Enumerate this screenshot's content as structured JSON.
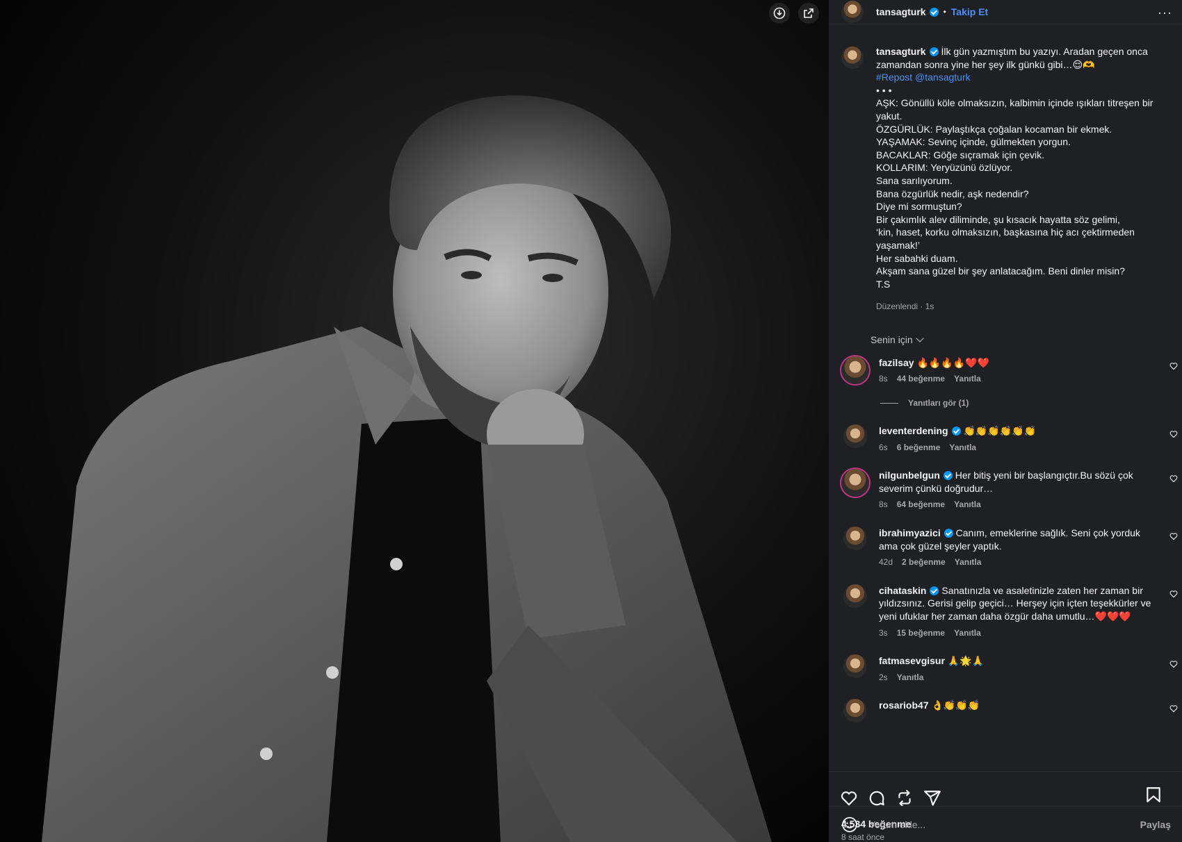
{
  "media": {
    "download_icon": "download-icon",
    "share_icon": "share-external-icon"
  },
  "post": {
    "author": "tansagturk",
    "follow_label": "Takip Et",
    "more_icon": "more-horizontal-icon",
    "caption_lines": [
      "İlk gün yazmıştım bu yazıyı. Aradan geçen onca zamandan sonra yine her şey ilk günkü gibi…😌🫶",
      "#Repost @tansagturk",
      "• • •",
      "AŞK: Gönüllü köle olmaksızın, kalbimin içinde ışıkları titreşen bir yakut.",
      "ÖZGÜRLÜK: Paylaştıkça çoğalan kocaman bir ekmek.",
      "YAŞAMAK: Sevinç içinde, gülmekten yorgun.",
      "BACAKLAR: Göğe sıçramak için çevik.",
      "KOLLARIM: Yeryüzünü özlüyor.",
      "Sana sarılıyorum.",
      "Bana özgürlük nedir, aşk nedendir?",
      "Diye mi sormuştun?",
      "Bir çakımlık alev diliminde, şu kısacık hayatta söz gelimi,",
      "‘kin, haset, korku olmaksızın, başkasına hiç acı çektirmeden yaşamak!’",
      "Her sabahki duam.",
      "Akşam sana güzel bir şey anlatacağım. Beni dinler misin?",
      "T.S"
    ],
    "caption_meta": "Düzenlendi · 1s",
    "filter_label": "Senin için",
    "likes": "4.534 beğenme",
    "time_ago": "8 saat önce"
  },
  "comments": [
    {
      "user": "fazilsay",
      "verified": false,
      "text": "🔥🔥🔥🔥❤️❤️",
      "age": "8s",
      "likes": "44 beğenme",
      "reply": "Yanıtla",
      "view_replies": "Yanıtları gör (1)"
    },
    {
      "user": "leventerdening",
      "verified": true,
      "text": "👏👏👏👏👏👏",
      "age": "6s",
      "likes": "6 beğenme",
      "reply": "Yanıtla"
    },
    {
      "user": "nilgunbelgun",
      "verified": true,
      "text": "Her bitiş yeni bir başlangıçtır.Bu sözü çok severim çünkü doğrudur…",
      "age": "8s",
      "likes": "64 beğenme",
      "reply": "Yanıtla"
    },
    {
      "user": "ibrahimyazici",
      "verified": true,
      "text": "Canım, emeklerine sağlık. Seni çok yorduk ama çok güzel şeyler yaptık.",
      "age": "42d",
      "likes": "2 beğenme",
      "reply": "Yanıtla"
    },
    {
      "user": "cihataskin",
      "verified": true,
      "text": "Sanatınızla ve asaletinizle zaten her zaman bir yıldızsınız. Gerisi gelip geçici… Herşey için içten teşekkürler ve yeni ufuklar her zaman daha özgür daha umutlu…❤️❤️❤️",
      "age": "3s",
      "likes": "15 beğenme",
      "reply": "Yanıtla"
    },
    {
      "user": "fatmasevgisur",
      "verified": false,
      "text": "🙏🌟🙏",
      "age": "2s",
      "likes": "",
      "reply": "Yanıtla"
    },
    {
      "user": "rosariob47",
      "verified": false,
      "text": "👌👏👏👏",
      "age": "",
      "likes": "",
      "reply": ""
    }
  ],
  "composer": {
    "placeholder": "Yorum ekle...",
    "post_label": "Paylaş"
  },
  "colors": {
    "panel_bg": "#1f2024",
    "link_blue": "#4f8ff7",
    "verified_blue": "#0095f6",
    "muted_text": "#a8a8a8"
  }
}
